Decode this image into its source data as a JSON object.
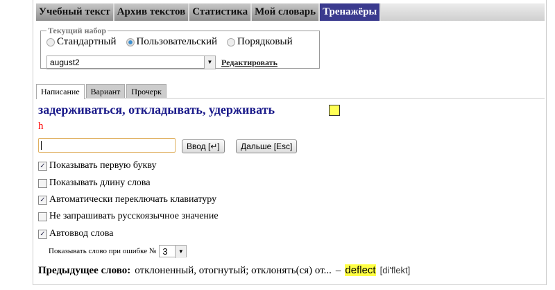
{
  "nav": [
    "Учебный текст",
    "Архив текстов",
    "Статистика",
    "Мой словарь",
    "Тренажёры"
  ],
  "set": {
    "legend": "Текущий набор",
    "options": [
      "Стандартный",
      "Пользовательский",
      "Порядковый"
    ],
    "selected": "august2",
    "edit": "Редактировать"
  },
  "tabs": [
    "Написание",
    "Вариант",
    "Прочерк"
  ],
  "word": "задерживаться, откладывать, удерживать",
  "hint": "h",
  "input_value": "",
  "buttons": {
    "enter": "Ввод [↵]",
    "next": "Дальше [Esc]"
  },
  "checks": [
    {
      "label": "Показывать первую букву",
      "checked": true
    },
    {
      "label": "Показывать длину слова",
      "checked": false
    },
    {
      "label": "Автоматически переключать клавиатуру",
      "checked": true
    },
    {
      "label": "Не запрашивать русскоязычное значение",
      "checked": false
    },
    {
      "label": "Автоввод слова",
      "checked": true
    }
  ],
  "error": {
    "label": "Показывать слово при ошибке №",
    "value": "3"
  },
  "prev": {
    "label": "Предыдущее слово:",
    "translation": "отклоненный, отогнутый; отклонять(ся) от...",
    "dash": "–",
    "word": "deflect",
    "transcription": "[di'flekt]"
  }
}
